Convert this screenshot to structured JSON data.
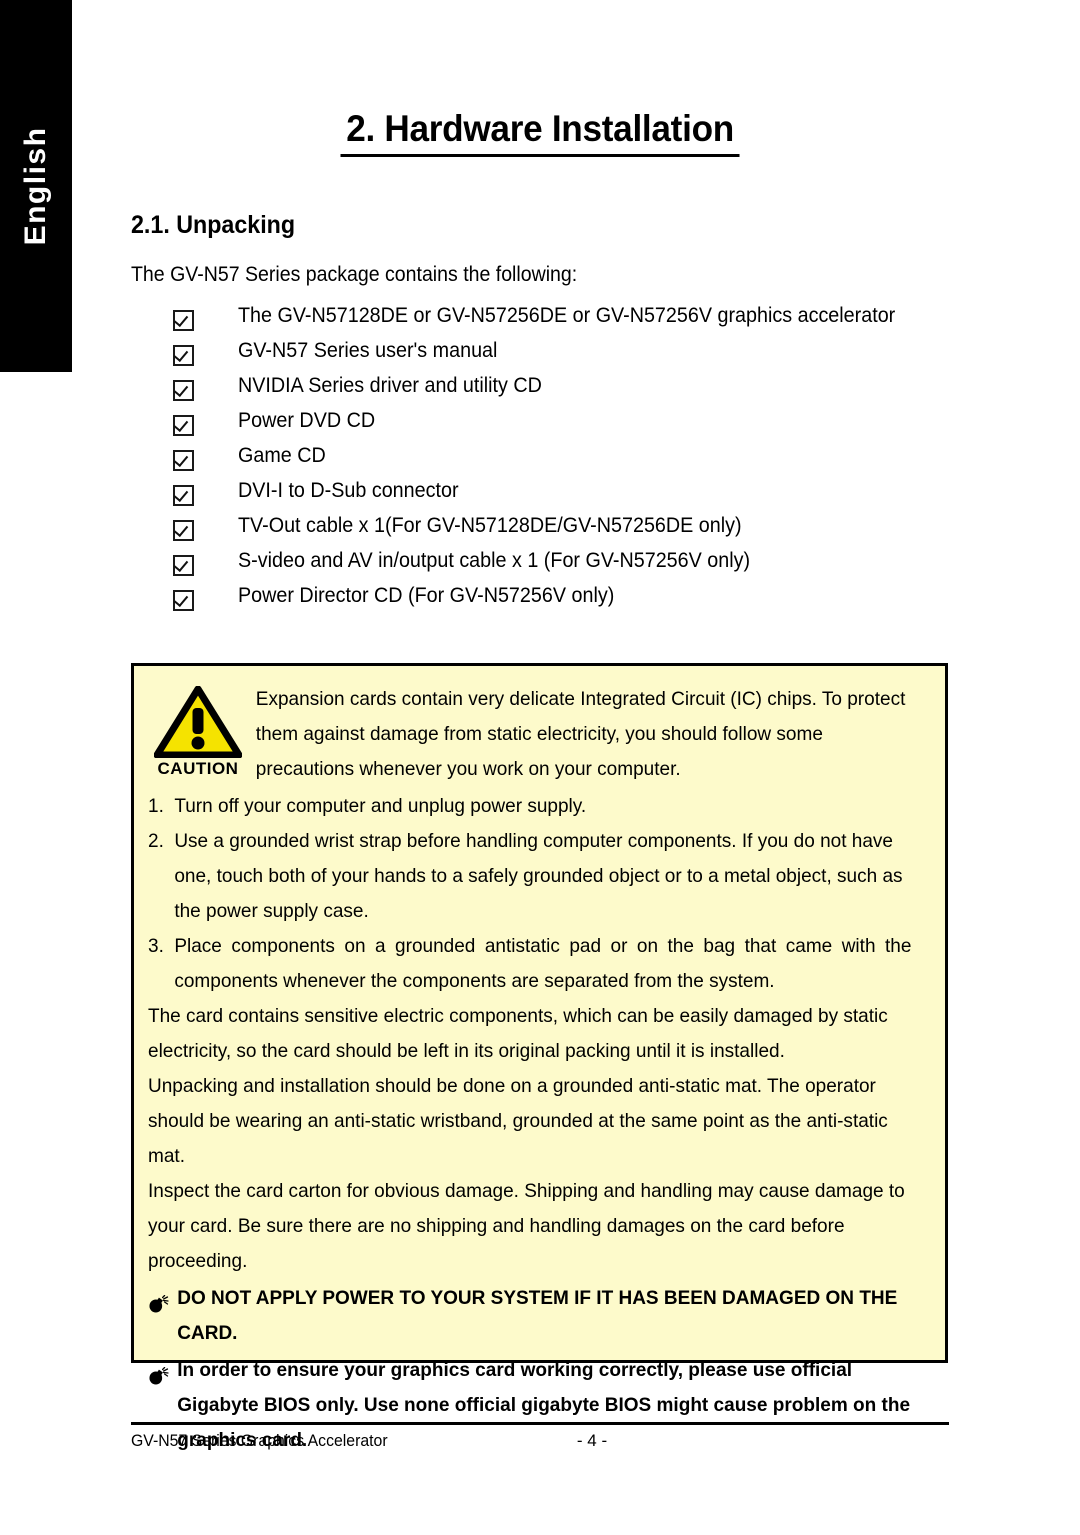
{
  "sidebar": {
    "language_tab": "English"
  },
  "header": {
    "chapter_title": "2. Hardware Installation",
    "section_heading": "2.1. Unpacking",
    "intro_line": "The GV-N57 Series package contains the following:"
  },
  "package_contents": [
    "The GV-N57128DE or GV-N57256DE or GV-N57256V graphics accelerator",
    "GV-N57 Series user's manual",
    "NVIDIA Series driver and utility CD",
    "Power DVD CD",
    "Game CD",
    "DVI-I to D-Sub connector",
    "TV-Out cable x 1(For GV-N57128DE/GV-N57256DE only)",
    "S-video and AV in/output cable x 1 (For GV-N57256V only)",
    "Power Director CD (For GV-N57256V only)"
  ],
  "caution": {
    "icon_label": "CAUTION",
    "intro": "Expansion cards contain very delicate Integrated Circuit (IC) chips. To protect them against damage from static electricity, you should follow some precautions whenever you work on your computer.",
    "steps": [
      {
        "num": "1.",
        "text": "Turn off your computer and unplug power supply."
      },
      {
        "num": "2.",
        "text": "Use a grounded wrist strap before handling computer components. If you do not have one, touch both of your hands to a safely grounded object or to a metal object, such as the power supply case."
      },
      {
        "num": "3.",
        "text": "Place components on a grounded antistatic pad or on the bag that came with the components whenever the components are separated from the system."
      }
    ],
    "paragraphs": [
      "The card contains sensitive electric components, which can be easily damaged by static electricity, so the card should be left in its original packing until it is installed.",
      "Unpacking and installation should be done on a grounded anti-static mat. The operator should be wearing an anti-static wristband, grounded at the same point as the anti-static mat.",
      "Inspect the card carton for obvious damage. Shipping and handling may cause damage to your card. Be sure there are no shipping and handling damages on the card before proceeding."
    ],
    "warnings": [
      "DO NOT APPLY POWER TO YOUR SYSTEM IF IT HAS BEEN DAMAGED ON THE CARD.",
      "In order to ensure your graphics card working correctly, please use official Gigabyte BIOS only. Use none official gigabyte BIOS might cause problem on the graphics card."
    ]
  },
  "footer": {
    "left": "GV-N57 Series Graphics Accelerator",
    "page": "- 4 -"
  },
  "colors": {
    "caution_background": "#fdfacb",
    "caution_triangle": "#f5e300",
    "tab_background": "#000000",
    "text": "#000000"
  }
}
